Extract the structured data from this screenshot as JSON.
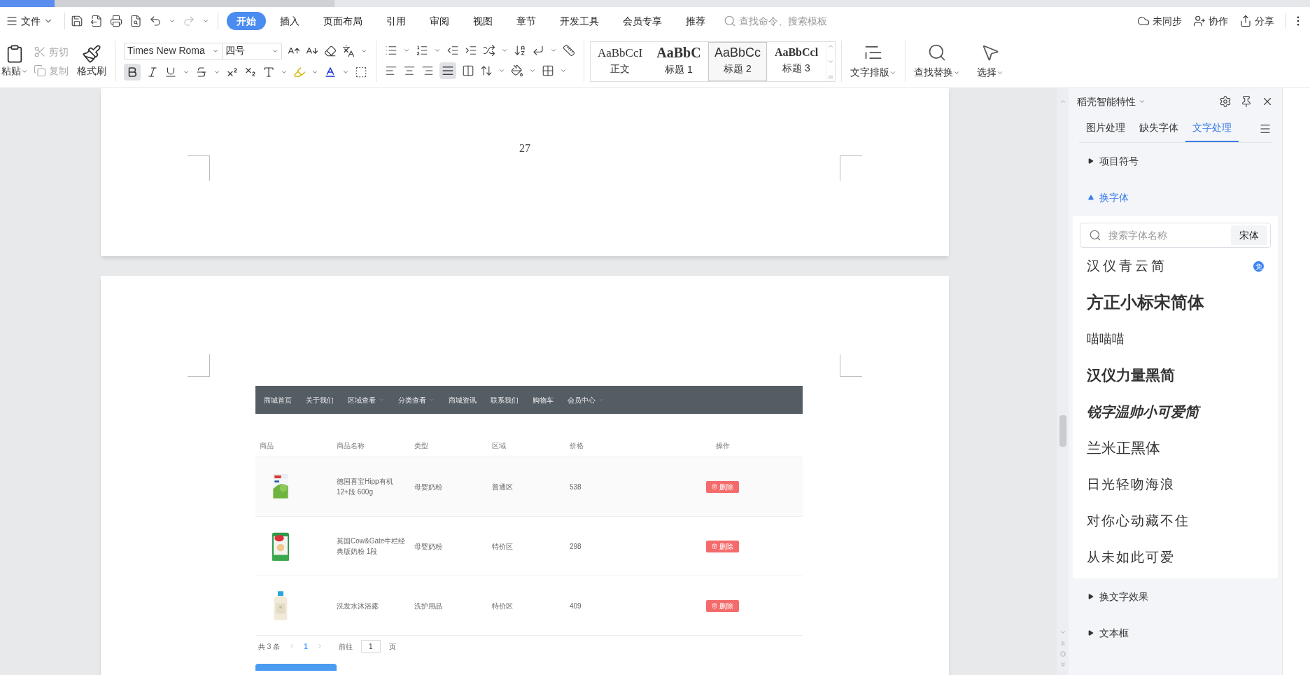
{
  "menu": {
    "file": "文件",
    "tabs": [
      {
        "label": "开始",
        "selected": true
      },
      {
        "label": "插入",
        "selected": false
      },
      {
        "label": "页面布局",
        "selected": false
      },
      {
        "label": "引用",
        "selected": false
      },
      {
        "label": "审阅",
        "selected": false
      },
      {
        "label": "视图",
        "selected": false
      },
      {
        "label": "章节",
        "selected": false
      },
      {
        "label": "开发工具",
        "selected": false
      },
      {
        "label": "会员专享",
        "selected": false
      },
      {
        "label": "推荐",
        "selected": false
      }
    ],
    "search_placeholder": "查找命令、搜索模板",
    "actions": [
      "未同步",
      "协作",
      "分享"
    ]
  },
  "ribbon": {
    "paste": "粘贴",
    "cut": {
      "label": "剪切",
      "disabled": true
    },
    "copy": {
      "label": "复制",
      "disabled": true
    },
    "format_painter": "格式刷",
    "font_family": "Times New Roma",
    "font_size": "四号",
    "bold": {
      "on": true
    },
    "justify": {
      "on": true
    },
    "styles": [
      {
        "preview": "AaBbCcI",
        "label": "正文",
        "selected": false
      },
      {
        "preview": "AaBbC",
        "label": "标题 1",
        "selected": false
      },
      {
        "preview": "AaBbCc",
        "label": "标题 2",
        "selected": true
      },
      {
        "preview": "AaBbCcl",
        "label": "标题 3",
        "selected": false
      }
    ],
    "layout": "文字排版",
    "find": "查找替换",
    "select": "选择"
  },
  "document": {
    "page_number": "27",
    "web": {
      "nav": [
        {
          "label": "商城首页",
          "dropdown": false
        },
        {
          "label": "关于我们",
          "dropdown": false
        },
        {
          "label": "区域查看",
          "dropdown": true
        },
        {
          "label": "分类查看",
          "dropdown": true
        },
        {
          "label": "商城资讯",
          "dropdown": false
        },
        {
          "label": "联系我们",
          "dropdown": false
        },
        {
          "label": "购物车",
          "dropdown": false
        },
        {
          "label": "会员中心",
          "dropdown": true
        }
      ],
      "columns": [
        "商品",
        "商品名称",
        "类型",
        "区域",
        "价格",
        "操作"
      ],
      "rows": [
        {
          "name": "德国喜宝Hipp有机 12+段 600g",
          "type": "母婴奶粉",
          "region": "普通区",
          "price": "538",
          "action": "删除"
        },
        {
          "name": "英国Cow&Gate牛栏经典版奶粉 1段",
          "type": "母婴奶粉",
          "region": "特价区",
          "price": "298",
          "action": "删除"
        },
        {
          "name": "洗发水沐浴露",
          "type": "洗护用品",
          "region": "特价区",
          "price": "409",
          "action": "删除"
        }
      ],
      "pagination": {
        "total": "共 3 条",
        "pages": [
          {
            "label": "1",
            "selected": true
          }
        ],
        "goto": "前往",
        "page_input": "1",
        "page_unit": "页"
      }
    }
  },
  "panel": {
    "title": "稻壳智能特性",
    "tabs": [
      {
        "label": "图片处理",
        "selected": false
      },
      {
        "label": "缺失字体",
        "selected": false
      },
      {
        "label": "文字处理",
        "selected": true
      }
    ],
    "sections": [
      {
        "label": "项目符号",
        "expanded": false
      },
      {
        "label": "换字体",
        "expanded": true
      },
      {
        "label": "换文字效果",
        "expanded": false
      },
      {
        "label": "文本框",
        "expanded": false
      }
    ],
    "font_search_placeholder": "搜索字体名称",
    "current_font": "宋体",
    "fonts": [
      {
        "name": "汉仪青云简",
        "badge": "免"
      },
      {
        "name": "方正小标宋简体"
      },
      {
        "name": "喵喵喵"
      },
      {
        "name": "汉仪力量黑简"
      },
      {
        "name": "锐字温帅小可爱简"
      },
      {
        "name": "兰米正黑体"
      },
      {
        "name": "日光轻吻海浪"
      },
      {
        "name": "对你心动藏不住"
      },
      {
        "name": "从未如此可爱"
      }
    ]
  }
}
